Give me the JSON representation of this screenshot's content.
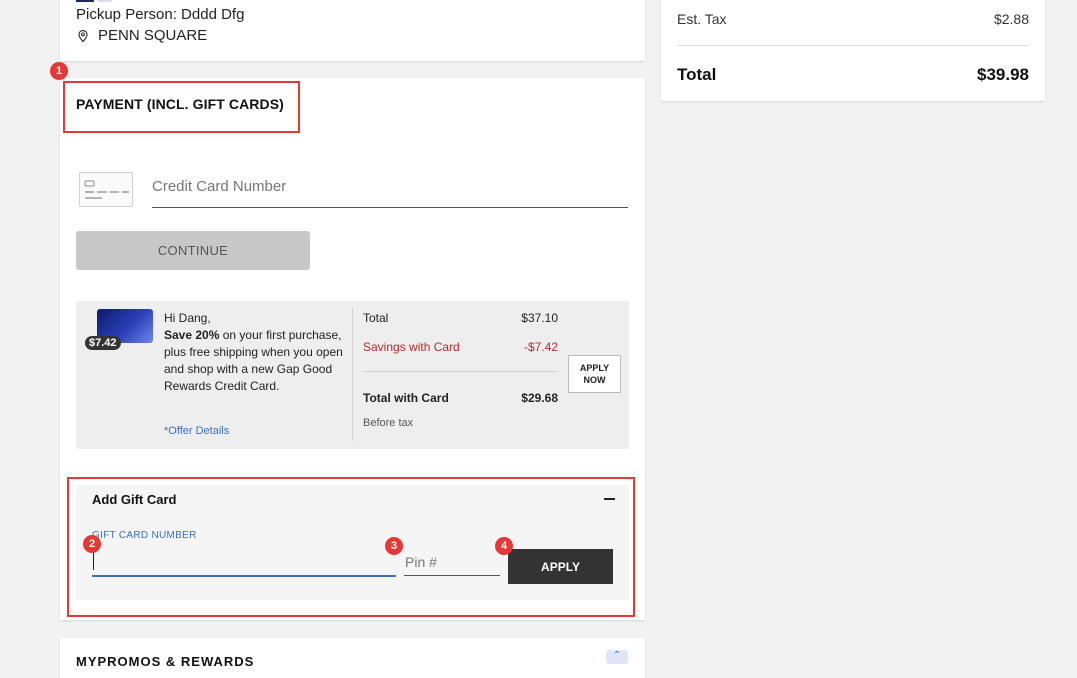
{
  "pickup": {
    "person": "Pickup Person: Dddd Dfg",
    "location": "PENN SQUARE",
    "location_icon": "location-pin-icon"
  },
  "payment": {
    "title": "PAYMENT (INCL. GIFT CARDS)",
    "card_icon": "credit-card-icon",
    "cc_placeholder": "Credit Card Number",
    "continue_label": "CONTINUE"
  },
  "promo": {
    "badge": "$7.42",
    "greeting": "Hi Dang,",
    "bold_text": "Save 20%",
    "body_text": " on your first purchase, plus free shipping when you open and shop with a new Gap Good Rewards Credit Card.",
    "offer_link": "*Offer Details",
    "total_label": "Total",
    "total_value": "$37.10",
    "savings_label": "Savings with Card",
    "savings_value": "-$7.42",
    "total_with_card_label": "Total with Card",
    "total_with_card_value": "$29.68",
    "before_tax": "Before tax",
    "apply_now_line1": "APPLY",
    "apply_now_line2": "NOW"
  },
  "gift_card": {
    "title": "Add Gift Card",
    "collapse_icon": "minus-icon",
    "number_label": "GIFT CARD NUMBER",
    "number_value": "",
    "pin_placeholder": "Pin #",
    "apply_label": "APPLY"
  },
  "bottom": {
    "title": "MYPROMOS & REWARDS",
    "toggle_icon": "chevron-up-icon"
  },
  "summary": {
    "tax_label": "Est. Tax",
    "tax_value": "$2.88",
    "total_label": "Total",
    "total_value": "$39.98"
  },
  "annotations": {
    "markers": [
      "1",
      "2",
      "3",
      "4"
    ],
    "color": "#e53935"
  },
  "colors": {
    "accent_blue": "#3b6fb6",
    "savings_red": "#b22a2a",
    "button_dark": "#333333",
    "button_disabled": "#c9c8c8"
  }
}
